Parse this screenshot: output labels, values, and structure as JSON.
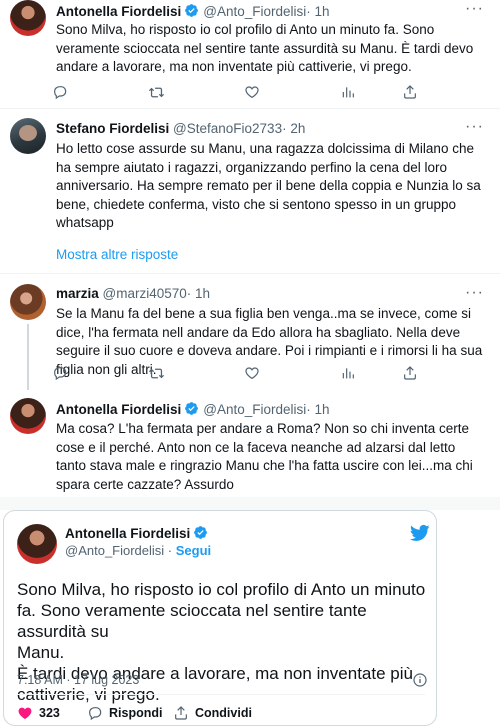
{
  "tweets": [
    {
      "name": "Antonella Fiordelisi",
      "handle": "@Anto_Fiordelisi",
      "time": "· 1h",
      "text": "Sono Milva, ho risposto io col profilo di Anto un minuto fa. Sono veramente scioccata nel sentire tante assurdità su Manu. È tardi devo andare a lavorare, ma non inventate più cattiverie, vi prego.",
      "verified": true
    },
    {
      "name": "Stefano Fiordelisi",
      "handle": "@StefanoFio2733",
      "time": "· 2h",
      "text": "Ho letto cose assurde su Manu, una ragazza dolcissima di Milano che ha sempre aiutato i ragazzi, organizzando perfino la cena del loro anniversario. Ha sempre remato per il bene della coppia e Nunzia lo sa bene, chiedete conferma, visto che si sentono spesso in un gruppo whatsapp",
      "verified": false
    },
    {
      "name": "marzia",
      "handle": "@marzi40570",
      "time": "· 1h",
      "text": "Se la Manu fa del bene a sua figlia ben venga..ma se invece, come si dice, l'ha fermata nell andare da Edo allora ha sbagliato. Nella deve seguire il suo cuore e doveva andare. Poi i rimpianti e i rimorsi li ha sua figlia non gli altri.",
      "verified": false
    },
    {
      "name": "Antonella Fiordelisi",
      "handle": "@Anto_Fiordelisi",
      "time": "· 1h",
      "text": "Ma cosa? L'ha fermata per andare a Roma? Non so chi inventa certe cose e il perché. Anto non ce la faceva neanche ad alzarsi dal letto tanto stava male e ringrazio Manu che l'ha fatta uscire con lei...ma chi spara certe cazzate? Assurdo",
      "verified": true
    }
  ],
  "more_menu": "···",
  "show_more_replies": "Mostra altre risposte",
  "embed": {
    "name": "Antonella Fiordelisi",
    "handle": "@Anto_Fiordelisi",
    "dot": " · ",
    "follow": "Segui",
    "text_lines": [
      "Sono Milva, ho risposto io col profilo di Anto un minuto",
      "fa. Sono veramente scioccata nel sentire tante assurdità su",
      "Manu.",
      "È tardi devo andare a lavorare, ma non inventate più",
      "cattiverie, vi prego."
    ],
    "timestamp": "7:18 AM · 17 lug 2023",
    "likes": "323",
    "reply_label": "Rispondi",
    "share_label": "Condividi"
  },
  "icons": {
    "reply": "reply-icon",
    "retweet": "retweet-icon",
    "like": "heart-icon",
    "views": "views-icon",
    "share": "share-icon",
    "verified": "verified-badge-icon",
    "info": "info-icon",
    "logo": "twitter-logo-icon"
  },
  "colors": {
    "accent": "#1d9bf0",
    "like": "#f91880",
    "text": "#0f1419",
    "secondary": "#536471"
  }
}
